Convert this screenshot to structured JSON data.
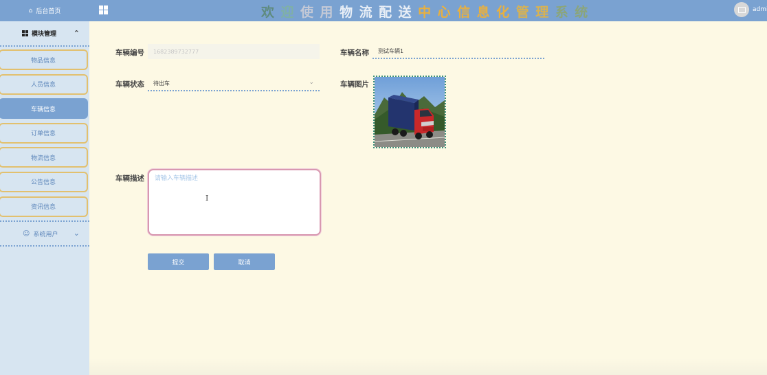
{
  "sidebar": {
    "home_label": "后台首页",
    "section_label": "模块管理",
    "items": [
      {
        "label": "物品信息"
      },
      {
        "label": "人员信息"
      },
      {
        "label": "车辆信息"
      },
      {
        "label": "订单信息"
      },
      {
        "label": "物流信息"
      },
      {
        "label": "公告信息"
      },
      {
        "label": "资讯信息"
      }
    ],
    "active_item": "车辆信息",
    "users_label": "系统用户"
  },
  "header": {
    "title_chars": [
      "欢",
      "迎",
      "使",
      "用",
      "物",
      "流",
      "配",
      "送",
      "中",
      "心",
      "信",
      "息",
      "化",
      "管",
      "理",
      "系",
      "统"
    ],
    "title_colors": [
      "#5f8b7e",
      "#7fb0a6",
      "#c4c9d6",
      "#c4c9d6",
      "#e8eef6",
      "#e8eef6",
      "#e8eef6",
      "#e8eef6",
      "#e8b040",
      "#e8b040",
      "#e8b040",
      "#e8b040",
      "#e8b040",
      "#d8b252",
      "#d8b252",
      "#8ba57a",
      "#8ba57a"
    ],
    "user_name": "admin"
  },
  "form": {
    "vehicle_no_label": "车辆编号",
    "vehicle_no_value": "1682389732777",
    "vehicle_name_label": "车辆名称",
    "vehicle_name_value": "测试车辆1",
    "status_label": "车辆状态",
    "status_value": "待出车",
    "image_label": "车辆图片",
    "desc_label": "车辆描述",
    "desc_placeholder": "请输入车辆描述",
    "submit_label": "提交",
    "cancel_label": "取消"
  },
  "colors": {
    "accent": "#7aa2d1",
    "background": "#fdf9e4",
    "sidebar": "#d7e5f1",
    "item_border": "#e2c06e"
  }
}
